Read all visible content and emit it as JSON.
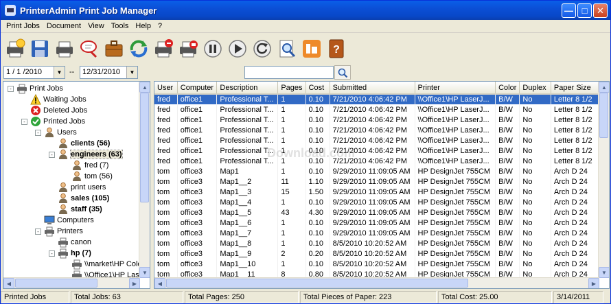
{
  "window": {
    "title": "PrinterAdmin Print Job Manager"
  },
  "menu": [
    "Print Jobs",
    "Document",
    "View",
    "Tools",
    "Help",
    "?"
  ],
  "toolbar": [
    "printer-add-icon",
    "save-icon",
    "printer-icon",
    "magnifier-bubble-icon",
    "briefcase-icon",
    "refresh-arrows-icon",
    "printer-delete-icon",
    "printer-stop-icon",
    "pause-icon",
    "play-icon",
    "restart-icon",
    "print-preview-icon",
    "report-icon",
    "help-book-icon"
  ],
  "filter": {
    "from_date": "1 / 1 /2010",
    "separator": "--",
    "to_date": "12/31/2010",
    "search_value": ""
  },
  "tree": [
    {
      "label": "Print Jobs",
      "level": 0,
      "expander": "-",
      "icon": "printer",
      "bold": false
    },
    {
      "label": "Waiting Jobs",
      "level": 1,
      "expander": "",
      "icon": "warning",
      "bold": false
    },
    {
      "label": "Deleted Jobs",
      "level": 1,
      "expander": "",
      "icon": "deleted",
      "bold": false
    },
    {
      "label": "Printed Jobs",
      "level": 1,
      "expander": "-",
      "icon": "check",
      "bold": false
    },
    {
      "label": "Users",
      "level": 2,
      "expander": "-",
      "icon": "user",
      "bold": false
    },
    {
      "label": "clients (56)",
      "level": 3,
      "expander": "",
      "icon": "user",
      "bold": true
    },
    {
      "label": "engineers (63)",
      "level": 3,
      "expander": "-",
      "icon": "user",
      "bold": true,
      "selected": true
    },
    {
      "label": "fred (7)",
      "level": 4,
      "expander": "",
      "icon": "user",
      "bold": false
    },
    {
      "label": "tom (56)",
      "level": 4,
      "expander": "",
      "icon": "user",
      "bold": false
    },
    {
      "label": "print users",
      "level": 3,
      "expander": "",
      "icon": "user",
      "bold": false
    },
    {
      "label": "sales (105)",
      "level": 3,
      "expander": "",
      "icon": "user",
      "bold": true
    },
    {
      "label": "staff (35)",
      "level": 3,
      "expander": "",
      "icon": "user",
      "bold": true
    },
    {
      "label": "Computers",
      "level": 2,
      "expander": "",
      "icon": "computer",
      "bold": false
    },
    {
      "label": "Printers",
      "level": 2,
      "expander": "-",
      "icon": "printer",
      "bold": false
    },
    {
      "label": "canon",
      "level": 3,
      "expander": "",
      "icon": "printer",
      "bold": false
    },
    {
      "label": "hp (7)",
      "level": 3,
      "expander": "-",
      "icon": "printer",
      "bold": true
    },
    {
      "label": "\\\\market\\HP Color",
      "level": 4,
      "expander": "",
      "icon": "printer",
      "bold": false
    },
    {
      "label": "\\\\Office1\\HP Las",
      "level": 4,
      "expander": "",
      "icon": "printer",
      "bold": false
    }
  ],
  "grid": {
    "columns": [
      "User",
      "Computer",
      "Description",
      "Pages",
      "Cost",
      "Submitted",
      "Printer",
      "Color",
      "Duplex",
      "Paper Size"
    ],
    "rows": [
      [
        "fred",
        "office1",
        "Professional T...",
        "1",
        "0.10",
        "7/21/2010 4:06:42 PM",
        "\\\\Office1\\HP LaserJ...",
        "B/W",
        "No",
        "Letter 8 1/2"
      ],
      [
        "fred",
        "office1",
        "Professional T...",
        "1",
        "0.10",
        "7/21/2010 4:06:42 PM",
        "\\\\Office1\\HP LaserJ...",
        "B/W",
        "No",
        "Letter 8 1/2"
      ],
      [
        "fred",
        "office1",
        "Professional T...",
        "1",
        "0.10",
        "7/21/2010 4:06:42 PM",
        "\\\\Office1\\HP LaserJ...",
        "B/W",
        "No",
        "Letter 8 1/2"
      ],
      [
        "fred",
        "office1",
        "Professional T...",
        "1",
        "0.10",
        "7/21/2010 4:06:42 PM",
        "\\\\Office1\\HP LaserJ...",
        "B/W",
        "No",
        "Letter 8 1/2"
      ],
      [
        "fred",
        "office1",
        "Professional T...",
        "1",
        "0.10",
        "7/21/2010 4:06:42 PM",
        "\\\\Office1\\HP LaserJ...",
        "B/W",
        "No",
        "Letter 8 1/2"
      ],
      [
        "fred",
        "office1",
        "Professional T...",
        "1",
        "0.10",
        "7/21/2010 4:06:42 PM",
        "\\\\Office1\\HP LaserJ...",
        "B/W",
        "No",
        "Letter 8 1/2"
      ],
      [
        "fred",
        "office1",
        "Professional T...",
        "1",
        "0.10",
        "7/21/2010 4:06:42 PM",
        "\\\\Office1\\HP LaserJ...",
        "B/W",
        "No",
        "Letter 8 1/2"
      ],
      [
        "tom",
        "office3",
        "Map1",
        "1",
        "0.10",
        "9/29/2010 11:09:05 AM",
        "HP DesignJet 755CM",
        "B/W",
        "No",
        "Arch D 24"
      ],
      [
        "tom",
        "office3",
        "Map1__2",
        "11",
        "1.10",
        "9/29/2010 11:09:05 AM",
        "HP DesignJet 755CM",
        "B/W",
        "No",
        "Arch D 24"
      ],
      [
        "tom",
        "office3",
        "Map1__3",
        "15",
        "1.50",
        "9/29/2010 11:09:05 AM",
        "HP DesignJet 755CM",
        "B/W",
        "No",
        "Arch D 24"
      ],
      [
        "tom",
        "office3",
        "Map1__4",
        "1",
        "0.10",
        "9/29/2010 11:09:05 AM",
        "HP DesignJet 755CM",
        "B/W",
        "No",
        "Arch D 24"
      ],
      [
        "tom",
        "office3",
        "Map1__5",
        "43",
        "4.30",
        "9/29/2010 11:09:05 AM",
        "HP DesignJet 755CM",
        "B/W",
        "No",
        "Arch D 24"
      ],
      [
        "tom",
        "office3",
        "Map1__6",
        "1",
        "0.10",
        "9/29/2010 11:09:05 AM",
        "HP DesignJet 755CM",
        "B/W",
        "No",
        "Arch D 24"
      ],
      [
        "tom",
        "office3",
        "Map1__7",
        "1",
        "0.10",
        "9/29/2010 11:09:05 AM",
        "HP DesignJet 755CM",
        "B/W",
        "No",
        "Arch D 24"
      ],
      [
        "tom",
        "office3",
        "Map1__8",
        "1",
        "0.10",
        "8/5/2010 10:20:52 AM",
        "HP DesignJet 755CM",
        "B/W",
        "No",
        "Arch D 24"
      ],
      [
        "tom",
        "office3",
        "Map1__9",
        "2",
        "0.20",
        "8/5/2010 10:20:52 AM",
        "HP DesignJet 755CM",
        "B/W",
        "No",
        "Arch D 24"
      ],
      [
        "tom",
        "office3",
        "Map1__10",
        "1",
        "0.10",
        "8/5/2010 10:20:52 AM",
        "HP DesignJet 755CM",
        "B/W",
        "No",
        "Arch D 24"
      ],
      [
        "tom",
        "office3",
        "Map1__11",
        "8",
        "0.80",
        "8/5/2010 10:20:52 AM",
        "HP DesignJet 755CM",
        "B/W",
        "No",
        "Arch D 24"
      ]
    ],
    "selected_row": 0
  },
  "status": [
    "Printed Jobs",
    "Total Jobs: 63",
    "Total Pages: 250",
    "Total Pieces of Paper: 223",
    "Total Cost: 25.00",
    "3/14/2011"
  ],
  "watermark": "Download.com",
  "colors": {
    "title_bar": "#0a5fe8",
    "selection": "#316ac5",
    "chrome": "#ece9d8"
  }
}
